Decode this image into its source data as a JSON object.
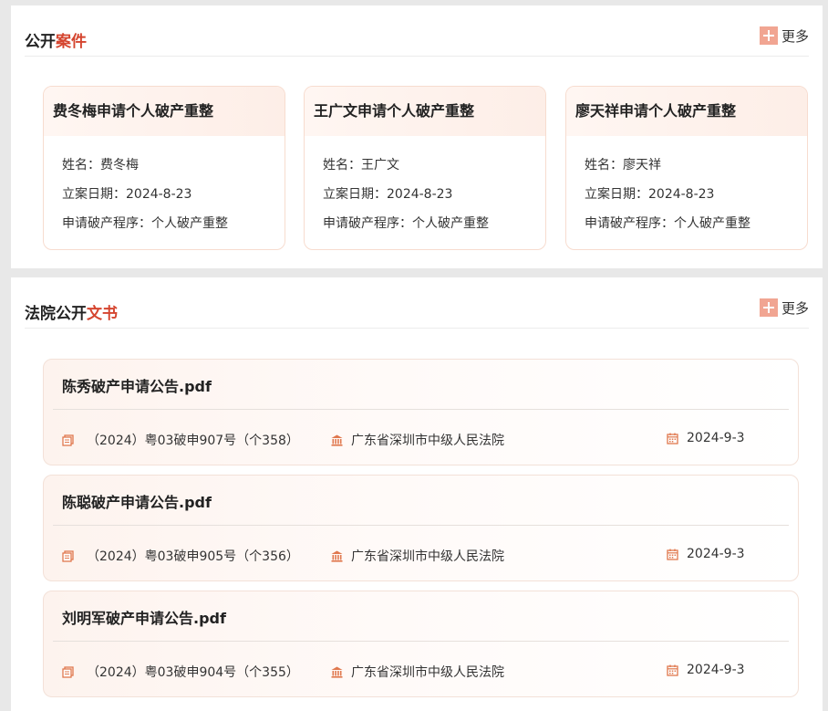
{
  "cases_section": {
    "title_main": "公开",
    "title_accent": "案件",
    "more_label": "更多",
    "cards": [
      {
        "title": "费冬梅申请个人破产重整",
        "name_line": "姓名：费冬梅",
        "date_line": "立案日期：2024-8-23",
        "procedure_line": "申请破产程序：个人破产重整"
      },
      {
        "title": "王广文申请个人破产重整",
        "name_line": "姓名：王广文",
        "date_line": "立案日期：2024-8-23",
        "procedure_line": "申请破产程序：个人破产重整"
      },
      {
        "title": "廖天祥申请个人破产重整",
        "name_line": "姓名：廖天祥",
        "date_line": "立案日期：2024-8-23",
        "procedure_line": "申请破产程序：个人破产重整"
      }
    ]
  },
  "docs_section": {
    "title_main": "法院公开",
    "title_accent": "文书",
    "more_label": "更多",
    "items": [
      {
        "title": "陈秀破产申请公告.pdf",
        "case_no": "（2024）粤03破申907号（个358）",
        "court": "广东省深圳市中级人民法院",
        "date": "2024-9-3"
      },
      {
        "title": "陈聪破产申请公告.pdf",
        "case_no": "（2024）粤03破申905号（个356）",
        "court": "广东省深圳市中级人民法院",
        "date": "2024-9-3"
      },
      {
        "title": "刘明军破产申请公告.pdf",
        "case_no": "（2024）粤03破申904号（个355）",
        "court": "广东省深圳市中级人民法院",
        "date": "2024-9-3"
      }
    ]
  },
  "icons": {
    "more": "plus-icon",
    "case_number": "document-icon",
    "court": "courthouse-icon",
    "date": "calendar-icon"
  },
  "colors": {
    "accent": "#d5452f",
    "icon": "#e0784e",
    "plus_bg": "#f1a592"
  }
}
